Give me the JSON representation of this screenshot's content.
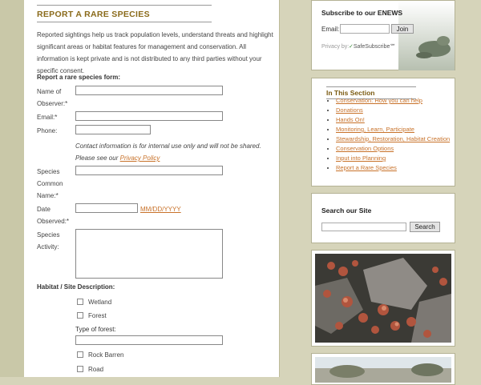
{
  "page": {
    "heading": "REPORT A RARE SPECIES",
    "intro": "Reported sightings help us track population levels, understand threats and highlight significant areas or habitat features for management and conservation. All information is kept private and is not distributed to any third parties without your specific consent."
  },
  "form": {
    "title": "Report a rare species form:",
    "name_label": "Name of Observer:*",
    "email_label": "Email:*",
    "phone_label": "Phone:",
    "contact_note": "Contact information is for internal use only and will not be shared. Please see our",
    "privacy_link": "Privacy Policy",
    "species_label": "Species Common Name:*",
    "date_label": "Date Observed:*",
    "date_hint": "MM/DD/YYYY",
    "activity_label": "Species Activity:",
    "habitat_title": "Habitat / Site Description:",
    "habitat_options": [
      "Wetland",
      "Forest",
      "Rock Barren",
      "Road"
    ],
    "forest_type_label": "Type of forest:"
  },
  "sidebar": {
    "enews": {
      "title": "Subscribe to our ENEWS",
      "email_label": "Email:",
      "join_label": "Join",
      "privacy_by": "Privacy by:",
      "safesubscribe": "SafeSubscribe℠"
    },
    "section": {
      "title": "In This Section",
      "links": [
        "Conservation: How you can help",
        "Donations",
        "Hands On!",
        "Monitoring, Learn, Participate",
        "Stewardship, Restoration, Habitat Creation",
        "Conservation Options",
        "Input into Planning",
        "Report a Rare Species"
      ]
    },
    "search": {
      "title": "Search our Site",
      "button_label": "Search"
    }
  },
  "colors": {
    "accent": "#c8722a",
    "heading": "#8a6a1a",
    "background": "#d6d4ba"
  }
}
